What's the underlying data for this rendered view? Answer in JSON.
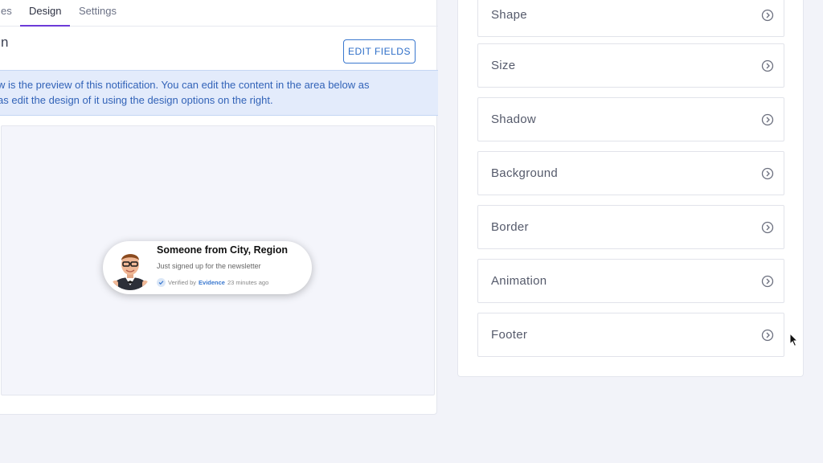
{
  "tabs": [
    {
      "label": "es"
    },
    {
      "label": "Design"
    },
    {
      "label": "Settings"
    }
  ],
  "panel": {
    "title": "n",
    "edit_button": "EDIT FIELDS",
    "info_line1": "w is the preview of this notification. You can edit the content in the area below as",
    "info_line2": "as edit the design of it using the design options on the right."
  },
  "notification": {
    "title": "Someone from City, Region",
    "subtitle": "Just signed up for the newsletter",
    "verified_prefix": "Verified by",
    "brand": "Evidence",
    "time": "23 minutes ago"
  },
  "design_options": [
    {
      "label": "Shape"
    },
    {
      "label": "Size"
    },
    {
      "label": "Shadow"
    },
    {
      "label": "Background"
    },
    {
      "label": "Border"
    },
    {
      "label": "Animation"
    },
    {
      "label": "Footer"
    }
  ],
  "colors": {
    "accent": "#6c3bd8",
    "link": "#2f6fc8",
    "info_bg": "#e3ebfb"
  }
}
